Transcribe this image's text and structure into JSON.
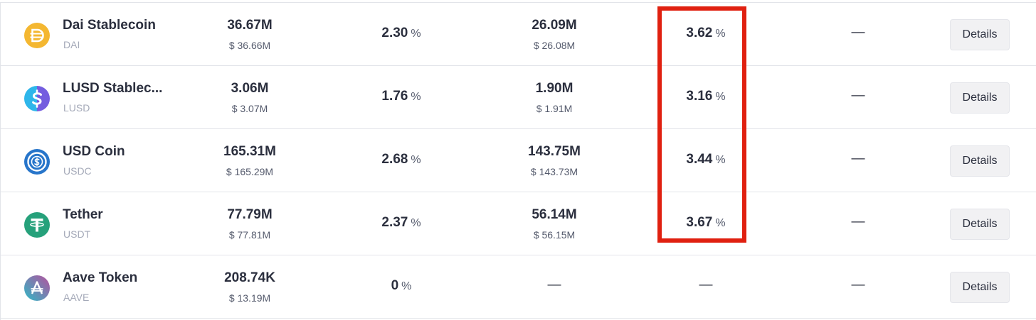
{
  "rows": [
    {
      "name": "Dai Stablecoin",
      "symbol": "DAI",
      "icon": "dai-icon",
      "icon_color": "#f4b731",
      "supply": "36.67M",
      "supply_usd": "$ 36.66M",
      "supply_apy": "2.30",
      "borrow": "26.09M",
      "borrow_usd": "$ 26.08M",
      "borrow_apy": "3.62",
      "stable_apy": "—",
      "action": "Details"
    },
    {
      "name": "LUSD Stablec...",
      "symbol": "LUSD",
      "icon": "lusd-icon",
      "icon_color": "#2eb6ea",
      "supply": "3.06M",
      "supply_usd": "$ 3.07M",
      "supply_apy": "1.76",
      "borrow": "1.90M",
      "borrow_usd": "$ 1.91M",
      "borrow_apy": "3.16",
      "stable_apy": "—",
      "action": "Details"
    },
    {
      "name": "USD Coin",
      "symbol": "USDC",
      "icon": "usdc-icon",
      "icon_color": "#2775ca",
      "supply": "165.31M",
      "supply_usd": "$ 165.29M",
      "supply_apy": "2.68",
      "borrow": "143.75M",
      "borrow_usd": "$ 143.73M",
      "borrow_apy": "3.44",
      "stable_apy": "—",
      "action": "Details"
    },
    {
      "name": "Tether",
      "symbol": "USDT",
      "icon": "tether-icon",
      "icon_color": "#26a17b",
      "supply": "77.79M",
      "supply_usd": "$ 77.81M",
      "supply_apy": "2.37",
      "borrow": "56.14M",
      "borrow_usd": "$ 56.15M",
      "borrow_apy": "3.67",
      "stable_apy": "—",
      "action": "Details"
    },
    {
      "name": "Aave Token",
      "symbol": "AAVE",
      "icon": "aave-icon",
      "icon_color": "#b6509e",
      "supply": "208.74K",
      "supply_usd": "$ 13.19M",
      "supply_apy": "0",
      "borrow": "—",
      "borrow_apy": "—",
      "stable_apy": "—",
      "action": "Details"
    }
  ],
  "percent_sign": "%",
  "highlight_color": "#e02010"
}
